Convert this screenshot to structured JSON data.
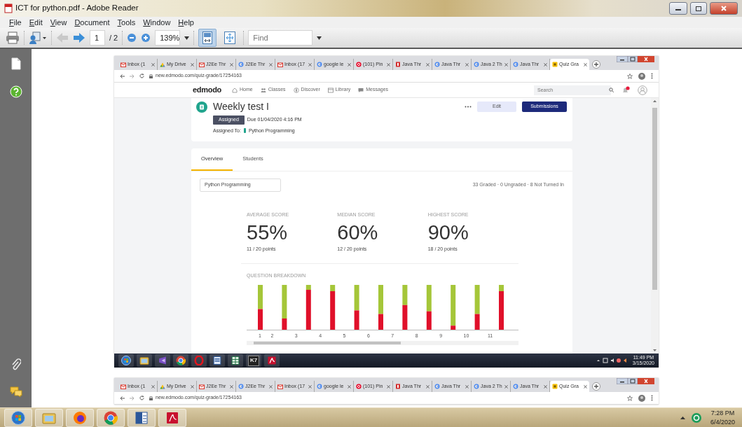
{
  "window": {
    "title": "ICT for python.pdf - Adobe Reader"
  },
  "menu": [
    "File",
    "Edit",
    "View",
    "Document",
    "Tools",
    "Window",
    "Help"
  ],
  "toolbar": {
    "back_disabled": true,
    "page": "1",
    "page_total": "/ 2",
    "zoom": "139%",
    "find_placeholder": "Find",
    "view_modes": [
      {
        "kind": "fit-width",
        "selected": true
      },
      {
        "kind": "fit-page",
        "selected": false
      }
    ]
  },
  "pages": [
    {
      "tabs": [
        {
          "kind": "gmail",
          "title": "Inbox (1",
          "selected": false
        },
        {
          "kind": "drive",
          "title": "My Drive",
          "selected": false
        },
        {
          "kind": "gmail",
          "title": "J2Ee Thr",
          "selected": false
        },
        {
          "kind": "google",
          "title": "J2Ee Thr",
          "selected": false
        },
        {
          "kind": "gmail",
          "title": "Inbox (17",
          "selected": false
        },
        {
          "kind": "google",
          "title": "google le",
          "selected": false
        },
        {
          "kind": "pinterest",
          "title": "(101) Pin",
          "selected": false
        },
        {
          "kind": "java",
          "title": "Java Thr",
          "selected": false
        },
        {
          "kind": "google",
          "title": "Java Thr",
          "selected": false
        },
        {
          "kind": "google",
          "title": "Java 2 Th",
          "selected": false
        },
        {
          "kind": "google",
          "title": "Java Thr",
          "selected": false
        },
        {
          "kind": "edmodo",
          "title": "Quiz Gra",
          "selected": true
        }
      ],
      "url": "new.edmodo.com/quiz-grade/17254163",
      "edmodo": {
        "logo": "edmodo",
        "nav": [
          {
            "kind": "home",
            "label": "Home"
          },
          {
            "kind": "classes",
            "label": "Classes"
          },
          {
            "kind": "discover",
            "label": "Discover"
          },
          {
            "kind": "library",
            "label": "Library"
          },
          {
            "kind": "messages",
            "label": "Messages"
          }
        ],
        "search_placeholder": "Search",
        "has_notification": true,
        "assignment": {
          "title": "Weekly test I",
          "status": "Assigned",
          "due": "Due 01/04/2020 4:16 PM",
          "assigned_to_label": "Assigned To:",
          "group": "Python Programming",
          "buttons": [
            {
              "kind": "secondary",
              "label": "Edit"
            },
            {
              "kind": "primary",
              "label": "Submissions"
            }
          ]
        },
        "tabs": [
          {
            "label": "Overview",
            "selected": true
          },
          {
            "label": "Students",
            "selected": false
          }
        ],
        "filter": {
          "value": "Python Programming"
        },
        "summary": "33 Graded · 0 Ungraded · 8 Not Turned In",
        "stats": [
          {
            "label": "AVERAGE SCORE",
            "value": "55%",
            "points": "11 / 20 points"
          },
          {
            "label": "MEDIAN SCORE",
            "value": "60%",
            "points": "12 / 20 points"
          },
          {
            "label": "HIGHEST SCORE",
            "value": "90%",
            "points": "18 / 20 points"
          }
        ],
        "breakdown": {
          "title": "QUESTION BREAKDOWN",
          "questions": [
            "1",
            "2",
            "3",
            "4",
            "5",
            "6",
            "7",
            "8",
            "9",
            "10",
            "11"
          ]
        }
      },
      "taskbar": {
        "apps": [
          {
            "kind": "start"
          },
          {
            "kind": "folder"
          },
          {
            "kind": "studio"
          },
          {
            "kind": "chrome"
          },
          {
            "kind": "opera"
          },
          {
            "kind": "docs"
          },
          {
            "kind": "sheet"
          },
          {
            "kind": "k7",
            "label": "K7"
          },
          {
            "kind": "pdf"
          }
        ],
        "time": "11:49 PM",
        "date": "3/15/2020"
      }
    },
    {
      "tabs": [
        {
          "kind": "gmail",
          "title": "Inbox (1",
          "selected": false
        },
        {
          "kind": "drive",
          "title": "My Drive",
          "selected": false
        },
        {
          "kind": "gmail",
          "title": "J2Ee Thr",
          "selected": false
        },
        {
          "kind": "google",
          "title": "J2Ee Thr",
          "selected": false
        },
        {
          "kind": "gmail",
          "title": "Inbox (17",
          "selected": false
        },
        {
          "kind": "google",
          "title": "google le",
          "selected": false
        },
        {
          "kind": "pinterest",
          "title": "(101) Pin",
          "selected": false
        },
        {
          "kind": "java",
          "title": "Java Thr",
          "selected": false
        },
        {
          "kind": "google",
          "title": "Java Thr",
          "selected": false
        },
        {
          "kind": "google",
          "title": "Java 2 Th",
          "selected": false
        },
        {
          "kind": "google",
          "title": "Java Thr",
          "selected": false
        },
        {
          "kind": "edmodo",
          "title": "Quiz Gra",
          "selected": true
        }
      ],
      "url": "new.edmodo.com/quiz-grade/17254163"
    }
  ],
  "taskbar": {
    "apps": [
      {
        "kind": "start"
      },
      {
        "kind": "folder"
      },
      {
        "kind": "firefox"
      },
      {
        "kind": "chrome"
      },
      {
        "kind": "word"
      },
      {
        "kind": "pdf"
      }
    ],
    "time": "7:28 PM",
    "date": "6/4/2020"
  }
}
